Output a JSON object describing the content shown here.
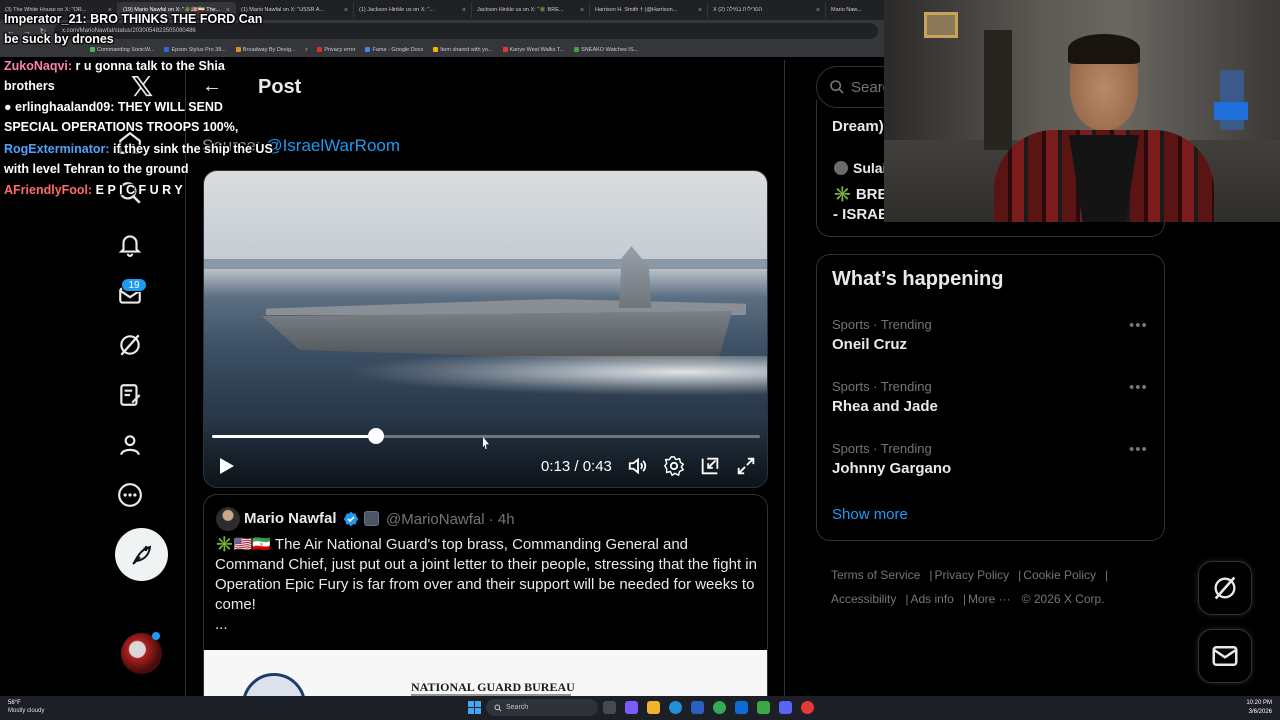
{
  "browser": {
    "tabs": [
      {
        "label": "(3) The White House on X: \"OR...",
        "active": false
      },
      {
        "label": "(19) Mario Nawfal on X: \"✳️🇺🇸🇮🇷 The...",
        "active": true
      },
      {
        "label": "(1) Mario Nawfal on X: \"USSR A...",
        "active": false
      },
      {
        "label": "(1) Jackson Hinkle us on X: \"...",
        "active": false
      },
      {
        "label": "Jackson Hinkle us on X: \"✳️ BRE...",
        "active": false
      },
      {
        "label": "Harrison H. Smith † (@Harrison...",
        "active": false
      },
      {
        "label": "X הסרילית במילה (2)",
        "active": false
      },
      {
        "label": "Mario Naw...",
        "active": false
      }
    ],
    "url": "x.com/MarioNawfal/status/2030054823505080486",
    "bookmarks": [
      "All Bookmarks",
      "Commanding SonicW...",
      "Epson Stylus Pro 38...",
      "Broadway By Desig...",
      "r",
      "Privacy error",
      "Fame - Google Docs",
      "Item shared with yo...",
      "Kanye West Walks T...",
      "SNEAKO Watches IS..."
    ]
  },
  "nav": {
    "logo": "𝕏",
    "notification_count": "19"
  },
  "header": {
    "back_label": "←",
    "title": "Post"
  },
  "source": {
    "prefix": "Source: ",
    "handle": "@IsraelWarRoom"
  },
  "video": {
    "current_time": "0:13",
    "duration": "0:43",
    "time_display": "0:13 / 0:43",
    "progress_fraction": 0.3
  },
  "tweet": {
    "author_name": "Mario Nawfal",
    "handle_time": "@MarioNawfal · 4h",
    "text": "✳️🇺🇸🇮🇷 The Air National Guard's top brass, Commanding General and Command Chief, just put out a joint letter to their people, stressing that the fight in Operation Epic Fury is far from over and their support will be needed for weeks to come!",
    "ellipsis": "...",
    "document_title": "NATIONAL GUARD BUREAU"
  },
  "sidebar": {
    "search_placeholder": "Search",
    "previous_card": {
      "top_text": "Dream)",
      "author": "Sulai",
      "breaking_line1": "✳️ BREA",
      "breaking_line2": "- ISRAE"
    },
    "happening": {
      "title": "What’s happening",
      "trends": [
        {
          "meta": "Sports · Trending",
          "name": "Oneil Cruz"
        },
        {
          "meta": "Sports · Trending",
          "name": "Rhea and Jade"
        },
        {
          "meta": "Sports · Trending",
          "name": "Johnny Gargano"
        }
      ],
      "show_more": "Show more"
    },
    "footer": {
      "terms": "Terms of Service",
      "privacy": "Privacy Policy",
      "cookie": "Cookie Policy",
      "accessibility": "Accessibility",
      "ads": "Ads info",
      "more": "More ···",
      "copyright": "© 2026 X Corp."
    }
  },
  "chat": [
    {
      "user": "",
      "message": "Imperator_21: BRO THINKS THE FORD Can be suck by drones",
      "color": "#ffffff"
    },
    {
      "user": "ZukoNaqvi:",
      "message": " r u gonna talk to the Shia brothers",
      "color": "#ff7fb0"
    },
    {
      "user": "● erlinghaaland09:",
      "message": " THEY WILL SEND SPECIAL OPERATIONS TROOPS 100%,",
      "color": "#ffffff"
    },
    {
      "user": "RogExterminator:",
      "message": " if they sink the ship the US with level Tehran to the ground",
      "color": "#4fa3ff"
    },
    {
      "user": "AFriendlyFool:",
      "message": " E P I C F U R Y",
      "color": "#ff6b6b"
    }
  ],
  "taskbar": {
    "weather_temp": "58°F",
    "weather_desc": "Mostly cloudy",
    "search_placeholder": "Search",
    "time": "10:20 PM",
    "date": "3/6/2026"
  },
  "colors": {
    "accent": "#1d9bf0",
    "background": "#000000",
    "text_primary": "#e7e9ea",
    "text_secondary": "#71767b",
    "border": "#2f3336"
  }
}
